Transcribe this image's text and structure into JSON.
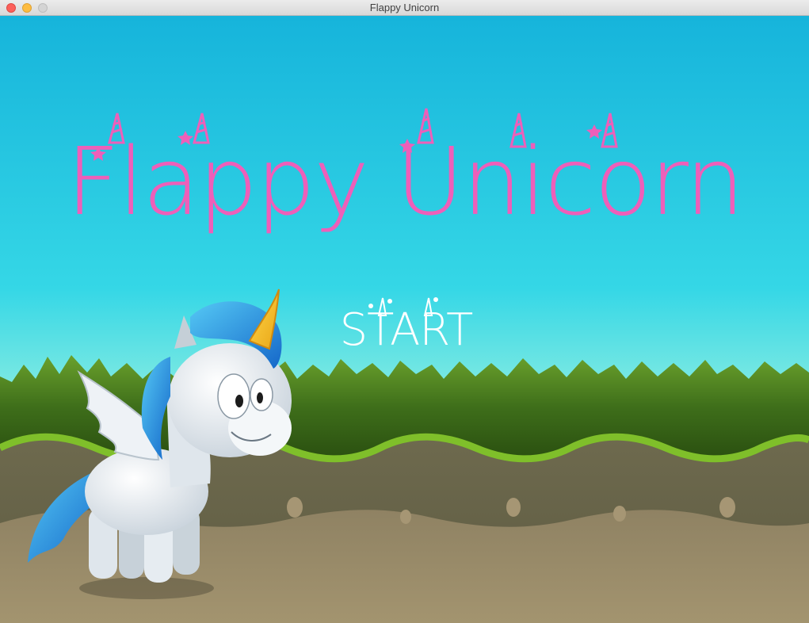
{
  "window": {
    "title": "Flappy Unicorn"
  },
  "game": {
    "title": "Flappy Unicorn",
    "start_label": "START"
  },
  "colors": {
    "sky_top": "#16b4db",
    "sky_bottom": "#7be8e2",
    "title_pink": "#ee5fb9",
    "grass": "#3e6e1a",
    "ground": "#8f8263"
  },
  "icons": {
    "mascot": "unicorn-character",
    "title_deco": "unicorn-horn-icon"
  }
}
